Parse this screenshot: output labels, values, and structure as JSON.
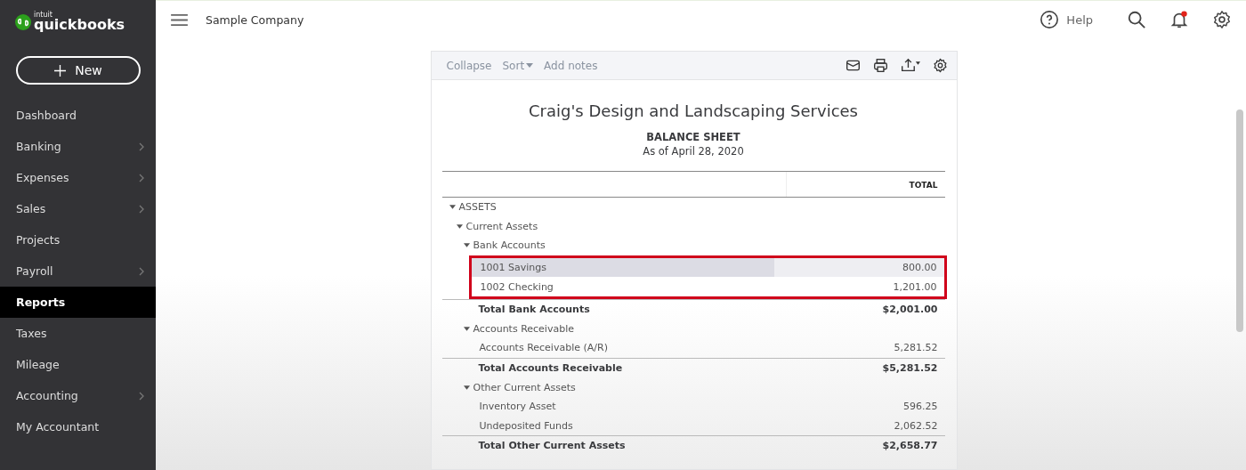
{
  "brand": {
    "small": "intuit",
    "name": "quickbooks"
  },
  "new_button": {
    "label": "New"
  },
  "sidebar": {
    "items": [
      {
        "label": "Dashboard",
        "selected": false,
        "has_submenu": false
      },
      {
        "label": "Banking",
        "selected": false,
        "has_submenu": true
      },
      {
        "label": "Expenses",
        "selected": false,
        "has_submenu": true
      },
      {
        "label": "Sales",
        "selected": false,
        "has_submenu": true
      },
      {
        "label": "Projects",
        "selected": false,
        "has_submenu": false
      },
      {
        "label": "Payroll",
        "selected": false,
        "has_submenu": true
      },
      {
        "label": "Reports",
        "selected": true,
        "has_submenu": false
      },
      {
        "label": "Taxes",
        "selected": false,
        "has_submenu": false
      },
      {
        "label": "Mileage",
        "selected": false,
        "has_submenu": false
      },
      {
        "label": "Accounting",
        "selected": false,
        "has_submenu": true
      },
      {
        "label": "My Accountant",
        "selected": false,
        "has_submenu": false
      }
    ]
  },
  "topbar": {
    "company": "Sample Company",
    "help": "Help",
    "notification": true
  },
  "report": {
    "toolbar": {
      "collapse": "Collapse",
      "sort": "Sort",
      "add_notes": "Add notes"
    },
    "company": "Craig's Design and Landscaping Services",
    "title": "BALANCE SHEET",
    "date": "As of April 28, 2020",
    "column": "TOTAL",
    "rows": [
      {
        "label": "ASSETS",
        "expanded": true,
        "children": [
          {
            "label": "Current Assets",
            "expanded": true,
            "children": [
              {
                "label": "Bank Accounts",
                "expanded": true,
                "boxed": true,
                "children": [
                  {
                    "label": "1001 Savings",
                    "amount": "800.00",
                    "hovered": true
                  },
                  {
                    "label": "1002 Checking",
                    "amount": "1,201.00",
                    "hovered": false
                  }
                ],
                "total": {
                  "label": "Total Bank Accounts",
                  "amount": "$2,001.00"
                }
              },
              {
                "label": "Accounts Receivable",
                "expanded": true,
                "boxed": false,
                "children": [
                  {
                    "label": "Accounts Receivable (A/R)",
                    "amount": "5,281.52",
                    "hovered": false
                  }
                ],
                "total": {
                  "label": "Total Accounts Receivable",
                  "amount": "$5,281.52"
                }
              },
              {
                "label": "Other Current Assets",
                "expanded": true,
                "boxed": false,
                "children": [
                  {
                    "label": "Inventory Asset",
                    "amount": "596.25",
                    "hovered": false
                  },
                  {
                    "label": "Undeposited Funds",
                    "amount": "2,062.52",
                    "hovered": false
                  }
                ],
                "total": {
                  "label": "Total Other Current Assets",
                  "amount": "$2,658.77"
                }
              }
            ]
          }
        ]
      }
    ]
  }
}
